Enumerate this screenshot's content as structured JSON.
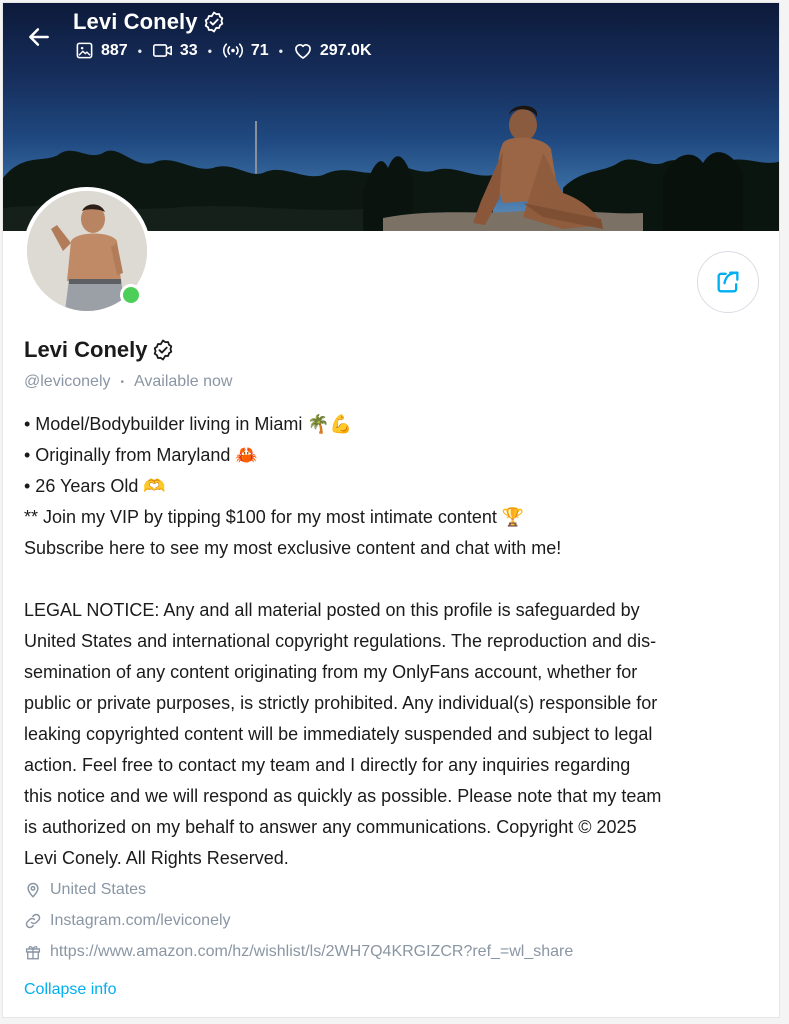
{
  "header": {
    "title": "Levi Conely",
    "stats": {
      "photos": "887",
      "videos": "33",
      "streams": "71",
      "likes": "297.0K"
    }
  },
  "profile": {
    "name": "Levi Conely",
    "handle": "@leviconely",
    "status": "Available now",
    "online": true
  },
  "bio": {
    "line1": "• Model/Bodybuilder living in Miami 🌴💪",
    "line2": "• Originally from Maryland 🦀",
    "line3": "• 26 Years Old 🫶",
    "line4": "** Join my VIP by tipping $100 for my most intimate content 🏆",
    "line5": "Subscribe here to see my most exclusive content and chat with me!",
    "legal": [
      "LEGAL NOTICE: Any and all material posted on this profile is safeguarded by",
      "United States and international copyright regulations. The reproduction and dis-",
      "semination of any content originating from my OnlyFans account, whether for",
      "public or private purposes, is strictly prohibited. Any individual(s) responsible for",
      "leaking copyrighted content will be immediately suspended and subject to legal",
      "action. Feel free to contact my team and I directly for any inquiries regarding",
      "this notice and we will respond as quickly as possible. Please note that my team",
      "is authorized on my behalf to answer any communications. Copyright © 2025",
      "Levi Conely. All Rights Reserved."
    ]
  },
  "meta": {
    "location": "United States",
    "website": "Instagram.com/leviconely",
    "wishlist": "https://www.amazon.com/hz/wishlist/ls/2WH7Q4KRGIZCR?ref_=wl_share"
  },
  "actions": {
    "collapse": "Collapse info"
  },
  "icons": [
    "back-arrow-icon",
    "verified-icon",
    "image-icon",
    "video-icon",
    "broadcast-icon",
    "heart-icon",
    "share-icon",
    "location-pin-icon",
    "link-icon",
    "gift-icon"
  ],
  "colors": {
    "accent": "#00aff0",
    "muted": "#8a96a3",
    "online": "#4ccf58"
  }
}
